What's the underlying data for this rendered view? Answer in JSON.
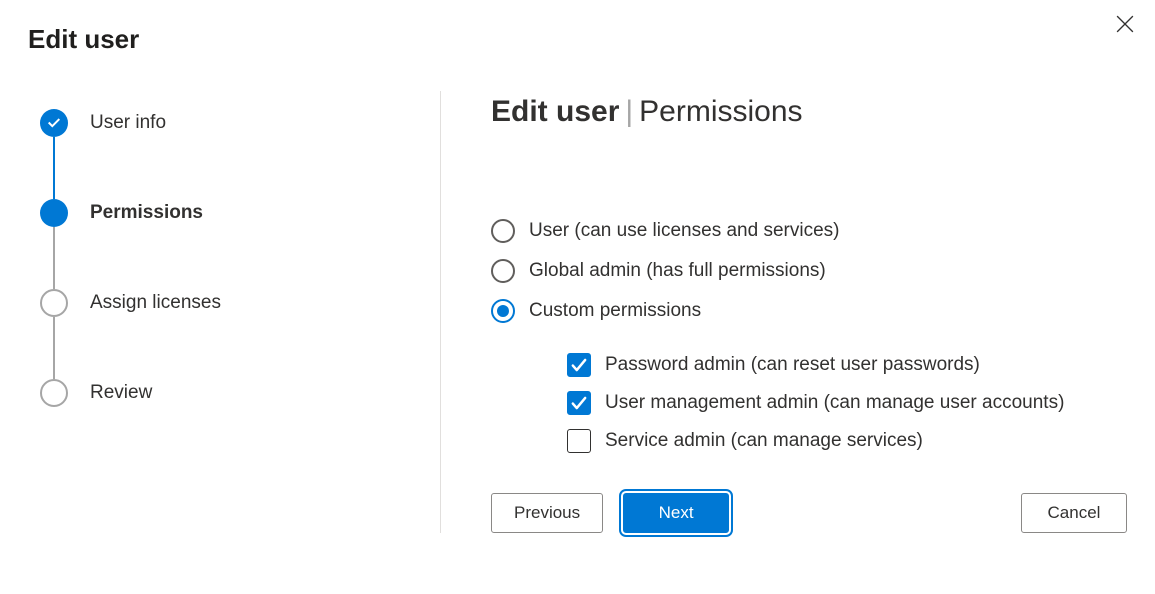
{
  "dialog": {
    "title": "Edit user",
    "close_label": "Close"
  },
  "stepper": {
    "steps": [
      {
        "label": "User info",
        "state": "completed"
      },
      {
        "label": "Permissions",
        "state": "current"
      },
      {
        "label": "Assign licenses",
        "state": "upcoming"
      },
      {
        "label": "Review",
        "state": "upcoming"
      }
    ]
  },
  "panel": {
    "heading_bold": "Edit user",
    "heading_light": "Permissions",
    "radios": {
      "user": {
        "label": "User (can use licenses and services)",
        "selected": false
      },
      "global_admin": {
        "label": "Global admin (has full permissions)",
        "selected": false
      },
      "custom": {
        "label": "Custom permissions",
        "selected": true
      }
    },
    "checkboxes": {
      "password_admin": {
        "label": "Password admin (can reset user passwords)",
        "checked": true
      },
      "user_mgmt_admin": {
        "label": "User management admin (can manage user accounts)",
        "checked": true
      },
      "service_admin": {
        "label": "Service admin (can manage services)",
        "checked": false
      }
    }
  },
  "buttons": {
    "previous": "Previous",
    "next": "Next",
    "cancel": "Cancel"
  }
}
